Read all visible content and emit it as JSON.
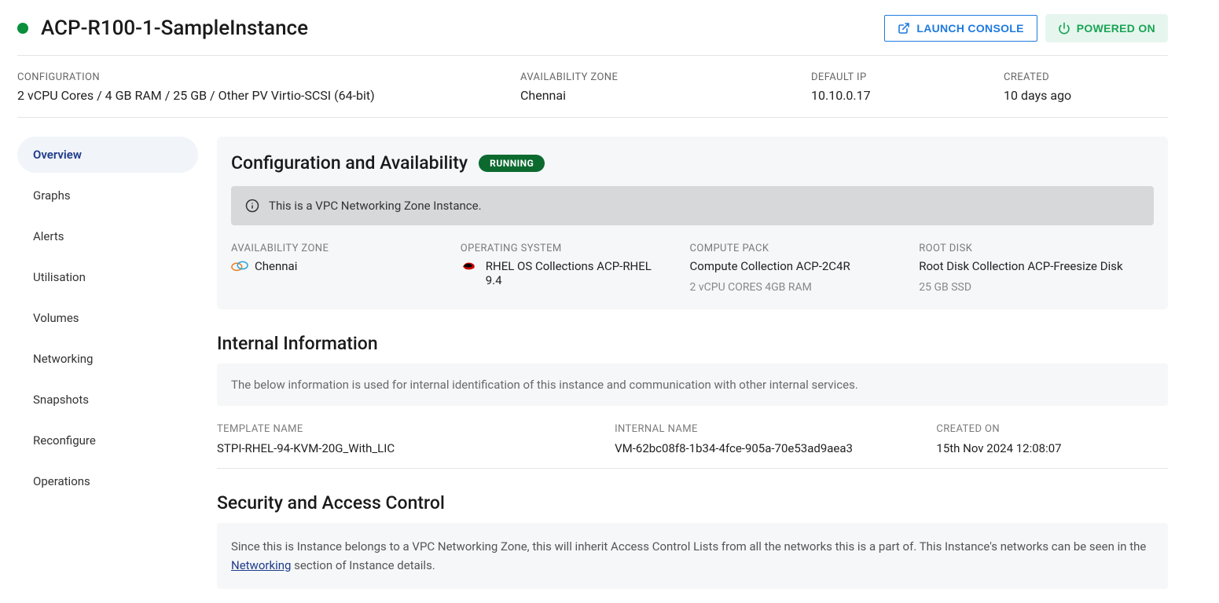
{
  "header": {
    "title": "ACP-R100-1-SampleInstance",
    "launch_label": "LAUNCH CONSOLE",
    "power_label": "POWERED ON"
  },
  "meta": {
    "config_label": "CONFIGURATION",
    "config_value": "2 vCPU Cores / 4 GB RAM / 25 GB / Other PV Virtio-SCSI (64-bit)",
    "az_label": "AVAILABILITY ZONE",
    "az_value": "Chennai",
    "ip_label": "DEFAULT IP",
    "ip_value": "10.10.0.17",
    "created_label": "CREATED",
    "created_value": "10 days ago"
  },
  "sidebar": {
    "items": [
      {
        "label": "Overview",
        "active": true
      },
      {
        "label": "Graphs"
      },
      {
        "label": "Alerts"
      },
      {
        "label": "Utilisation"
      },
      {
        "label": "Volumes"
      },
      {
        "label": "Networking"
      },
      {
        "label": "Snapshots"
      },
      {
        "label": "Reconfigure"
      },
      {
        "label": "Operations"
      }
    ]
  },
  "config_panel": {
    "title": "Configuration and Availability",
    "status_badge": "RUNNING",
    "notice": "This is a VPC Networking Zone Instance.",
    "az_label": "AVAILABILITY ZONE",
    "az_value": "Chennai",
    "os_label": "OPERATING SYSTEM",
    "os_value": "RHEL OS Collections ACP-RHEL 9.4",
    "compute_label": "COMPUTE PACK",
    "compute_value": "Compute Collection ACP-2C4R",
    "compute_sub": "2 vCPU CORES 4GB RAM",
    "disk_label": "ROOT DISK",
    "disk_value": "Root Disk Collection ACP-Freesize Disk",
    "disk_sub": "25 GB SSD"
  },
  "internal": {
    "title": "Internal Information",
    "note": "The below information is used for internal identification of this instance and communication with other internal services.",
    "template_label": "TEMPLATE NAME",
    "template_value": "STPI-RHEL-94-KVM-20G_With_LIC",
    "internal_label": "INTERNAL NAME",
    "internal_value": "VM-62bc08f8-1b34-4fce-905a-70e53ad9aea3",
    "created_label": "CREATED ON",
    "created_value": "15th Nov 2024 12:08:07"
  },
  "security": {
    "title": "Security and Access Control",
    "note_pre": "Since this is Instance belongs to a VPC Networking Zone, this will inherit Access Control Lists from all the networks this is a part of. This Instance's networks can be seen in the ",
    "link": "Networking",
    "note_post": " section of Instance details."
  }
}
